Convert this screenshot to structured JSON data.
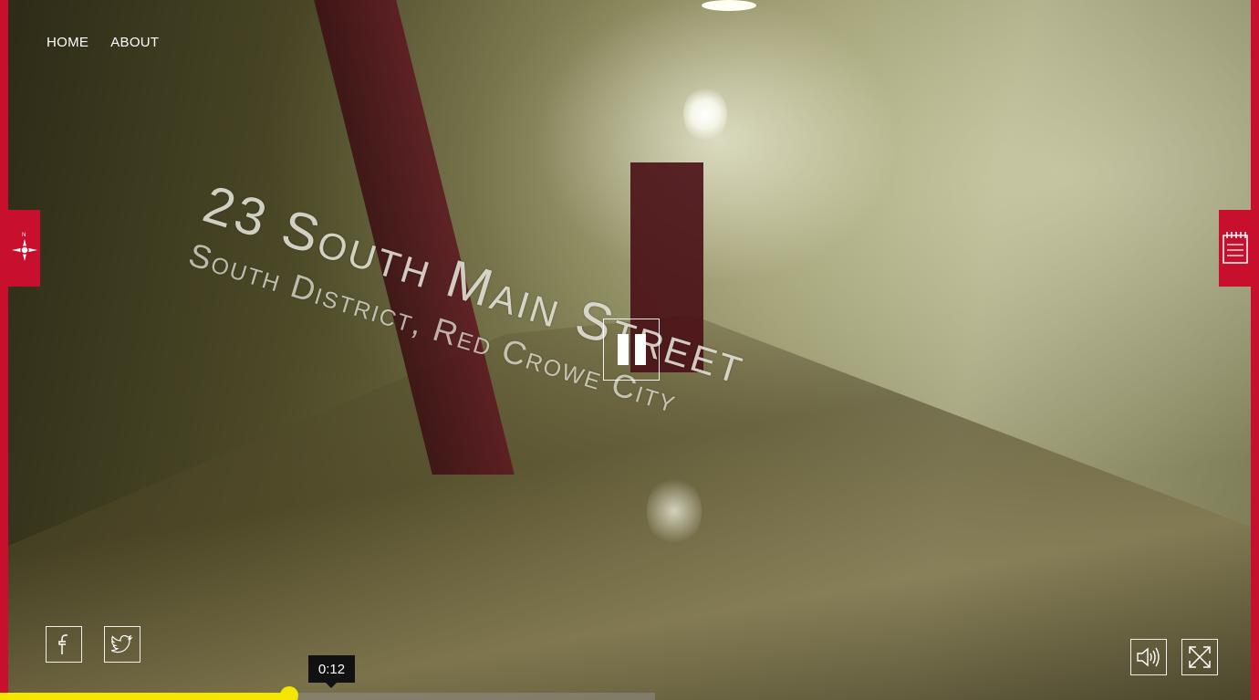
{
  "nav": {
    "home": "HOME",
    "about": "ABOUT"
  },
  "video": {
    "title_line1": "23 South Main Street",
    "title_line2": "South District, Red Crowe City",
    "current_time": "0:12",
    "progress": 0.23
  },
  "icons": {
    "left_tab": "compass-icon",
    "right_tab": "notebook-icon",
    "pause": "pause-icon",
    "facebook": "facebook-icon",
    "twitter": "twitter-icon",
    "volume": "volume-icon",
    "fullscreen": "fullscreen-icon"
  },
  "colors": {
    "accent_red": "#c8102e",
    "progress_yellow": "#f4e600"
  }
}
